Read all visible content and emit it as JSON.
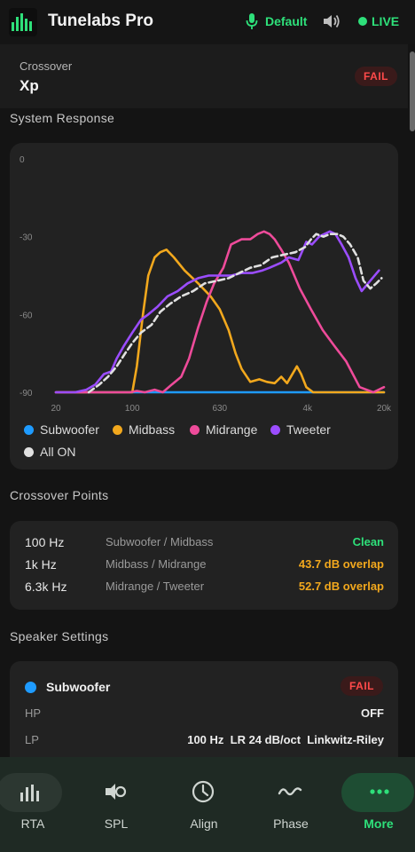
{
  "header": {
    "title": "Tunelabs Pro",
    "mic_label": "Default",
    "live_label": "LIVE"
  },
  "crossover_card": {
    "label": "Crossover",
    "value": "Xp",
    "status": "FAIL"
  },
  "colors": {
    "subwoofer": "#1e9bff",
    "midbass": "#f2a81d",
    "midrange": "#ee4b9a",
    "tweeter": "#9b4dff",
    "all_on": "#e0e0e0",
    "accent_green": "#2ee07a",
    "fail_red": "#ff4a4a",
    "overlap_orange": "#f2a81d"
  },
  "system_response": {
    "section_title": "System Response",
    "legend": [
      "Subwoofer",
      "Midbass",
      "Midrange",
      "Tweeter",
      "All ON"
    ]
  },
  "chart_data": {
    "type": "line",
    "x_scale": "log",
    "xlim": [
      20,
      20000
    ],
    "ylim": [
      -90,
      0
    ],
    "y_ticks": [
      "0",
      "-30",
      "-60",
      "-90"
    ],
    "x_ticks": [
      "20",
      "100",
      "630",
      "4k",
      "20k"
    ],
    "x_tick_values": [
      20,
      100,
      630,
      4000,
      20000
    ],
    "y_tick_values": [
      0,
      -30,
      -60,
      -90
    ],
    "series": [
      {
        "name": "Subwoofer",
        "color": "#1e9bff",
        "dashed": false,
        "points": [
          [
            30,
            -90
          ],
          [
            20000,
            -90
          ]
        ]
      },
      {
        "name": "Midbass",
        "color": "#f2a81d",
        "dashed": false,
        "points": [
          [
            20,
            -90
          ],
          [
            90,
            -90
          ],
          [
            100,
            -90
          ],
          [
            110,
            -80
          ],
          [
            125,
            -60
          ],
          [
            140,
            -45
          ],
          [
            160,
            -38
          ],
          [
            180,
            -36
          ],
          [
            205,
            -35
          ],
          [
            240,
            -38
          ],
          [
            300,
            -43
          ],
          [
            400,
            -48
          ],
          [
            520,
            -53
          ],
          [
            630,
            -58
          ],
          [
            760,
            -66
          ],
          [
            880,
            -75
          ],
          [
            1000,
            -81
          ],
          [
            1200,
            -86
          ],
          [
            1450,
            -85
          ],
          [
            1700,
            -86
          ],
          [
            2000,
            -86.5
          ],
          [
            2300,
            -84
          ],
          [
            2600,
            -86.5
          ],
          [
            3200,
            -80
          ],
          [
            3500,
            -83
          ],
          [
            3900,
            -88
          ],
          [
            4500,
            -90
          ],
          [
            20000,
            -90
          ]
        ]
      },
      {
        "name": "Midrange",
        "color": "#ee4b9a",
        "dashed": false,
        "points": [
          [
            20,
            -90
          ],
          [
            95,
            -90
          ],
          [
            110,
            -89.5
          ],
          [
            130,
            -90
          ],
          [
            160,
            -89
          ],
          [
            190,
            -90
          ],
          [
            230,
            -87
          ],
          [
            280,
            -84
          ],
          [
            330,
            -77
          ],
          [
            400,
            -65
          ],
          [
            480,
            -55
          ],
          [
            560,
            -48
          ],
          [
            680,
            -42
          ],
          [
            800,
            -33
          ],
          [
            1000,
            -31
          ],
          [
            1200,
            -31
          ],
          [
            1400,
            -29
          ],
          [
            1600,
            -28
          ],
          [
            1800,
            -29
          ],
          [
            2000,
            -31
          ],
          [
            2300,
            -35
          ],
          [
            2700,
            -40
          ],
          [
            3400,
            -50
          ],
          [
            4300,
            -58
          ],
          [
            5500,
            -66
          ],
          [
            7000,
            -72
          ],
          [
            9000,
            -78
          ],
          [
            12000,
            -88
          ],
          [
            16000,
            -90
          ],
          [
            20000,
            -88
          ]
        ]
      },
      {
        "name": "Tweeter",
        "color": "#9b4dff",
        "dashed": false,
        "points": [
          [
            20,
            -90
          ],
          [
            30,
            -90
          ],
          [
            38,
            -89
          ],
          [
            46,
            -87
          ],
          [
            55,
            -83
          ],
          [
            64,
            -82
          ],
          [
            72,
            -77
          ],
          [
            84,
            -72
          ],
          [
            100,
            -67
          ],
          [
            120,
            -62
          ],
          [
            140,
            -60
          ],
          [
            170,
            -57
          ],
          [
            210,
            -53
          ],
          [
            260,
            -51
          ],
          [
            320,
            -48
          ],
          [
            400,
            -46
          ],
          [
            500,
            -45
          ],
          [
            620,
            -45
          ],
          [
            800,
            -45
          ],
          [
            1000,
            -44
          ],
          [
            1250,
            -44
          ],
          [
            1550,
            -43
          ],
          [
            1800,
            -42
          ],
          [
            2300,
            -40
          ],
          [
            2700,
            -38
          ],
          [
            3300,
            -39
          ],
          [
            3900,
            -32
          ],
          [
            4400,
            -33
          ],
          [
            5100,
            -30
          ],
          [
            5700,
            -29
          ],
          [
            6400,
            -28
          ],
          [
            7200,
            -29
          ],
          [
            8200,
            -33
          ],
          [
            9500,
            -38
          ],
          [
            11000,
            -46
          ],
          [
            12500,
            -51
          ],
          [
            15000,
            -47
          ],
          [
            18000,
            -43
          ]
        ]
      },
      {
        "name": "All ON",
        "color": "#e0e0e0",
        "dashed": true,
        "points": [
          [
            40,
            -90
          ],
          [
            50,
            -87
          ],
          [
            60,
            -84
          ],
          [
            72,
            -80
          ],
          [
            86,
            -75
          ],
          [
            100,
            -71
          ],
          [
            120,
            -67
          ],
          [
            150,
            -64
          ],
          [
            180,
            -59
          ],
          [
            220,
            -56
          ],
          [
            280,
            -53
          ],
          [
            360,
            -51
          ],
          [
            460,
            -48
          ],
          [
            600,
            -47
          ],
          [
            760,
            -46
          ],
          [
            950,
            -44
          ],
          [
            1200,
            -42
          ],
          [
            1500,
            -41
          ],
          [
            1900,
            -38
          ],
          [
            2400,
            -37
          ],
          [
            3100,
            -36
          ],
          [
            3800,
            -34
          ],
          [
            4300,
            -31
          ],
          [
            4800,
            -29
          ],
          [
            5600,
            -30
          ],
          [
            6400,
            -29
          ],
          [
            7500,
            -29
          ],
          [
            8500,
            -30
          ],
          [
            9800,
            -33
          ],
          [
            11500,
            -38
          ],
          [
            13000,
            -47
          ],
          [
            15000,
            -50
          ],
          [
            17000,
            -48
          ],
          [
            19000,
            -46
          ]
        ]
      }
    ]
  },
  "crossover_points": {
    "section_title": "Crossover Points",
    "rows": [
      {
        "freq": "100 Hz",
        "pair": "Subwoofer / Midbass",
        "status": "Clean",
        "status_color": "#2ee07a"
      },
      {
        "freq": "1k Hz",
        "pair": "Midbass / Midrange",
        "status": "43.7 dB overlap",
        "status_color": "#f2a81d"
      },
      {
        "freq": "6.3k Hz",
        "pair": "Midrange / Tweeter",
        "status": "52.7 dB overlap",
        "status_color": "#f2a81d"
      }
    ]
  },
  "speaker_settings": {
    "section_title": "Speaker Settings",
    "speaker_name": "Subwoofer",
    "status": "FAIL",
    "hp_label": "HP",
    "hp_value": "OFF",
    "lp_label": "LP",
    "lp_value": "100 Hz  LR 24 dB/oct  Linkwitz-Riley"
  },
  "bottom_nav": {
    "items": [
      {
        "label": "RTA",
        "icon": "bars-icon",
        "active_pill": true
      },
      {
        "label": "SPL",
        "icon": "speaker-icon"
      },
      {
        "label": "Align",
        "icon": "clock-icon"
      },
      {
        "label": "Phase",
        "icon": "wave-icon"
      },
      {
        "label": "More",
        "icon": "more-icon",
        "active": true
      }
    ]
  }
}
